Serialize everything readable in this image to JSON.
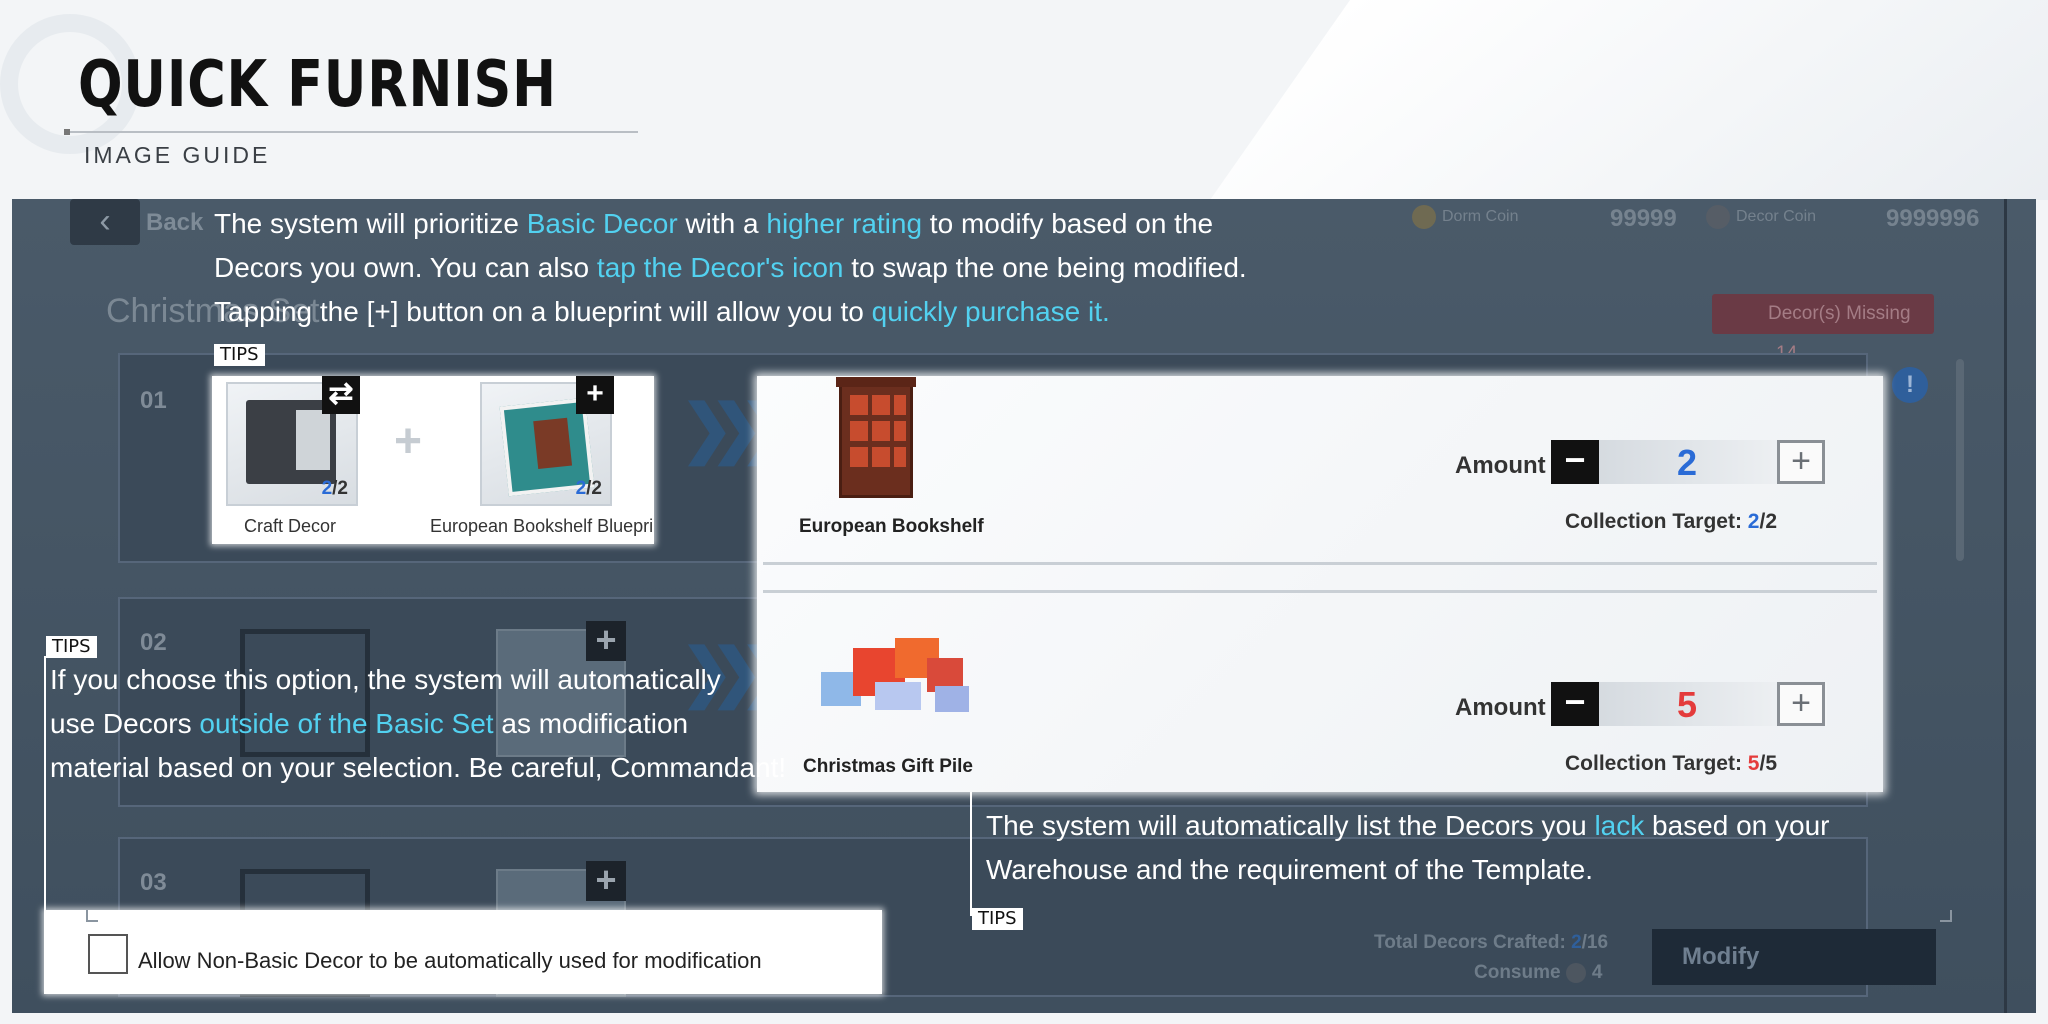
{
  "header": {
    "title": "QUICK FURNISH",
    "subtitle": "IMAGE GUIDE"
  },
  "game_ui": {
    "back_label": "Back",
    "currencies": [
      {
        "name": "Dorm Coin",
        "value": "99999"
      },
      {
        "name": "Decor Coin",
        "value": "9999996"
      }
    ],
    "set_title": "Christmas Set",
    "missing_label": "Decor(s) Missing",
    "missing_count": "14",
    "rows": [
      "01",
      "02",
      "03"
    ],
    "total_label": "Total Decors Crafted:",
    "total_done": "2",
    "total_of": "/16",
    "consume_label": "Consume",
    "consume_value": "4",
    "modify_label": "Modify"
  },
  "tips_label": "TIPS",
  "tip_top": {
    "line1_a": "The system will prioritize ",
    "line1_hl1": "Basic Decor",
    "line1_b": " with a ",
    "line1_hl2": "higher rating",
    "line1_c": " to modify based on the",
    "line2_a": "Decors you own. You can also ",
    "line2_hl": "tap the Decor's icon",
    "line2_b": " to swap the one being modified.",
    "line3_a": "Tapping the [+] button on a blueprint will allow you to ",
    "line3_hl": "quickly purchase it."
  },
  "craft": {
    "decor_caption": "Craft Decor",
    "decor_qty_have": "2",
    "decor_qty_need": "/2",
    "blueprint_caption": "European Bookshelf Bluepri",
    "blueprint_qty_have": "2",
    "blueprint_qty_need": "/2"
  },
  "detail": {
    "items": [
      {
        "name": "European Bookshelf",
        "amount_label": "Amount",
        "amount": "2",
        "target_label": "Collection Target:",
        "target_have": "2",
        "target_need": "/2"
      },
      {
        "name": "Christmas Gift Pile",
        "amount_label": "Amount",
        "amount": "5",
        "target_label": "Collection Target:",
        "target_have": "5",
        "target_need": "/5"
      }
    ]
  },
  "tip_left": {
    "line1": "If you choose this option, the system will automatically",
    "line2_a": "use Decors ",
    "line2_hl": "outside of the Basic Set",
    "line2_b": " as modification",
    "line3": "material based on your selection. Be careful, Commandant!"
  },
  "tip_right": {
    "line1_a": "The system will automatically list the Decors you ",
    "line1_hl": "lack",
    "line1_b": " based on your",
    "line2": "Warehouse and the requirement of the Template."
  },
  "checkbox_label": "Allow Non-Basic Decor to be automatically used for modification",
  "colors": {
    "highlight": "#52d1f0",
    "amount_ok": "#2a6bd6",
    "amount_warn": "#e43b3b"
  }
}
